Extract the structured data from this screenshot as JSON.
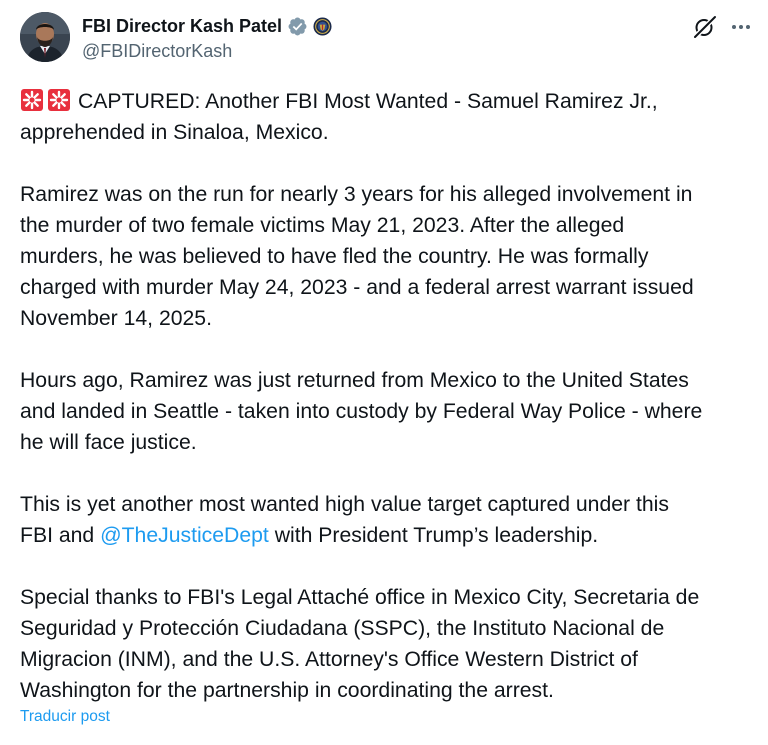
{
  "author": {
    "display_name": "FBI Director Kash Patel",
    "handle": "@FBIDirectorKash",
    "verified_icon": "verified-badge-icon",
    "affiliation_icon": "fbi-seal-icon"
  },
  "header_actions": {
    "grok_icon": "grok-icon",
    "more_icon": "more-dots-icon"
  },
  "post": {
    "p1": {
      "emoji": [
        "rotating-light-emoji",
        "rotating-light-emoji"
      ],
      "l1": "CAPTURED: Another FBI Most Wanted - Samuel Ramirez Jr.,",
      "l2": "apprehended in Sinaloa, Mexico."
    },
    "p2": {
      "l1": "Ramirez was on the run for nearly 3 years for his alleged involvement in",
      "l2": "the murder of two female victims May 21, 2023. After the alleged",
      "l3": "murders, he was believed to have fled the country. He was formally",
      "l4": "charged with murder May 24, 2023 - and a federal arrest warrant issued",
      "l5": "November 14, 2025."
    },
    "p3": {
      "l1": "Hours ago, Ramirez was just returned from Mexico to the United States",
      "l2": "and landed in Seattle - taken into custody by Federal Way Police - where",
      "l3": "he will face justice."
    },
    "p4": {
      "l1": "This is yet another most wanted high value target captured under this",
      "l2_before": "FBI and ",
      "l2_mention": "@TheJusticeDept",
      "l2_after": " with President Trump’s leadership."
    },
    "p5": {
      "l1": "Special thanks to FBI's Legal Attaché office in Mexico City, Secretaria de",
      "l2": "Seguridad y Protección Ciudadana (SSPC), the Instituto Nacional de",
      "l3": "Migracion (INM), and the U.S. Attorney's Office Western District of",
      "l4": "Washington for the partnership in coordinating the arrest."
    }
  },
  "translate_link": "Traducir post",
  "colors": {
    "text": "#0f1419",
    "secondary": "#536471",
    "link": "#1d9bf0",
    "verified": "#1d9bf0"
  }
}
